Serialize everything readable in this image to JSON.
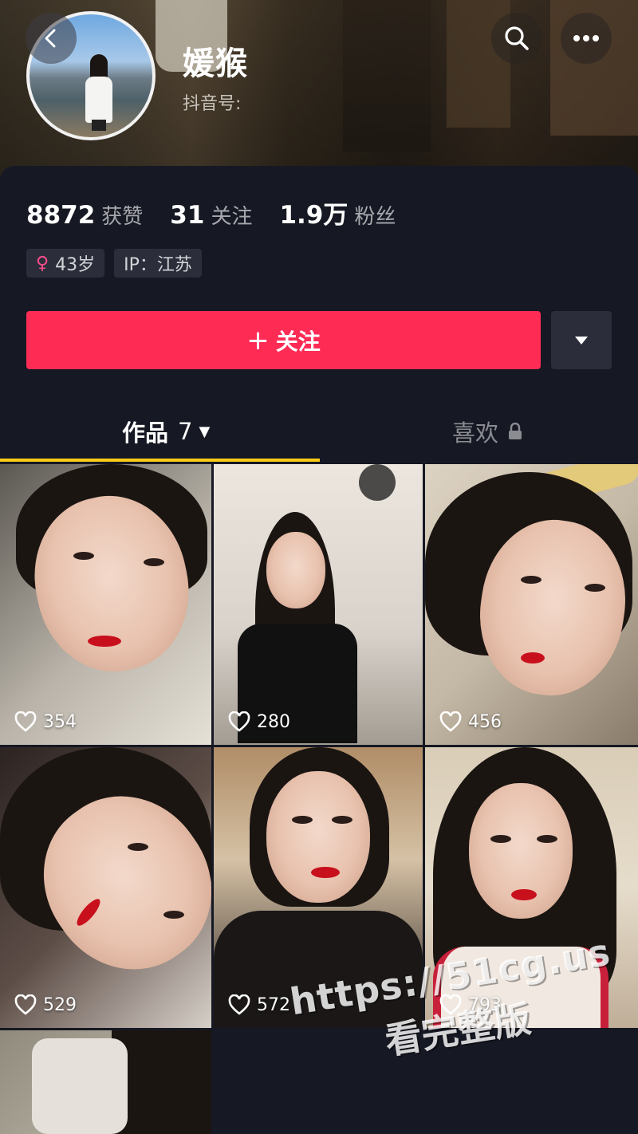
{
  "header": {
    "nickname": "媛猴",
    "douyin_id_label": "抖音号:",
    "back_icon": "chevron-left-icon",
    "search_icon": "search-icon",
    "more_icon": "more-horizontal-icon"
  },
  "stats": [
    {
      "value": "8872",
      "label": "获赞"
    },
    {
      "value": "31",
      "label": "关注"
    },
    {
      "value": "1.9万",
      "label": "粉丝"
    }
  ],
  "tags": {
    "age": "43岁",
    "ip": "IP：江苏"
  },
  "actions": {
    "follow_label": "关注",
    "follow_plus": "+",
    "accent_color": "#fe2c55"
  },
  "tabs": {
    "works_label": "作品",
    "works_count": "7",
    "likes_label": "喜欢",
    "underline_color": "#facc15"
  },
  "videos": [
    {
      "likes": "354"
    },
    {
      "likes": "280"
    },
    {
      "likes": "456"
    },
    {
      "likes": "529"
    },
    {
      "likes": "572"
    },
    {
      "likes": "793"
    }
  ],
  "watermark": {
    "url": "https://51cg.us",
    "text": "看完整版"
  }
}
